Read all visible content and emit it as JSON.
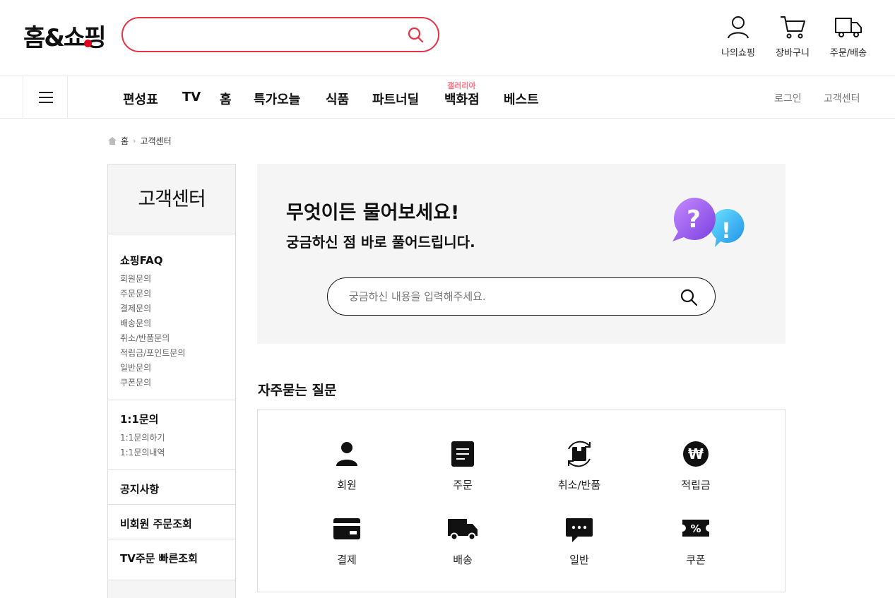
{
  "header": {
    "logo": "홈&쇼핑",
    "icons": [
      {
        "label": "나의쇼핑",
        "icon": "user-icon"
      },
      {
        "label": "장바구니",
        "icon": "cart-icon"
      },
      {
        "label": "주문/배송",
        "icon": "truck-icon"
      }
    ]
  },
  "nav": {
    "items": [
      "편성표",
      "TV",
      "홈",
      "특가오늘",
      "식품",
      "파트너딜",
      "백화점",
      "베스트"
    ],
    "gallery_tag": "갤러리아",
    "right": [
      "로그인",
      "고객센터"
    ]
  },
  "breadcrumb": {
    "home": "홈",
    "current": "고객센터"
  },
  "sidebar": {
    "title": "고객센터",
    "faq": {
      "title": "쇼핑FAQ",
      "items": [
        "회원문의",
        "주문문의",
        "결제문의",
        "배송문의",
        "취소/반품문의",
        "적립금/포인트문의",
        "일반문의",
        "쿠폰문의"
      ]
    },
    "inquiry": {
      "title": "1:1문의",
      "items": [
        "1:1문의하기",
        "1:1문의내역"
      ]
    },
    "links": [
      "공지사항",
      "비회원 주문조회",
      "TV주문 빠른조회"
    ]
  },
  "hero": {
    "title": "무엇이든 물어보세요!",
    "subtitle": "궁금하신 점 바로 풀어드립니다.",
    "search_placeholder": "궁금하신 내용을 입력해주세요.",
    "search_value": ""
  },
  "faq_section": {
    "title": "자주묻는 질문",
    "categories": [
      {
        "label": "회원",
        "icon": "member-icon"
      },
      {
        "label": "주문",
        "icon": "order-document-icon"
      },
      {
        "label": "취소/반품",
        "icon": "return-box-icon"
      },
      {
        "label": "적립금",
        "icon": "won-coin-icon"
      },
      {
        "label": "결제",
        "icon": "credit-card-icon"
      },
      {
        "label": "배송",
        "icon": "delivery-truck-icon"
      },
      {
        "label": "일반",
        "icon": "chat-bubble-icon"
      },
      {
        "label": "쿠폰",
        "icon": "coupon-icon"
      }
    ]
  },
  "colors": {
    "accent": "#e63244",
    "brand_dot": "#e0001b",
    "gallery_tag": "#ff6e80"
  }
}
